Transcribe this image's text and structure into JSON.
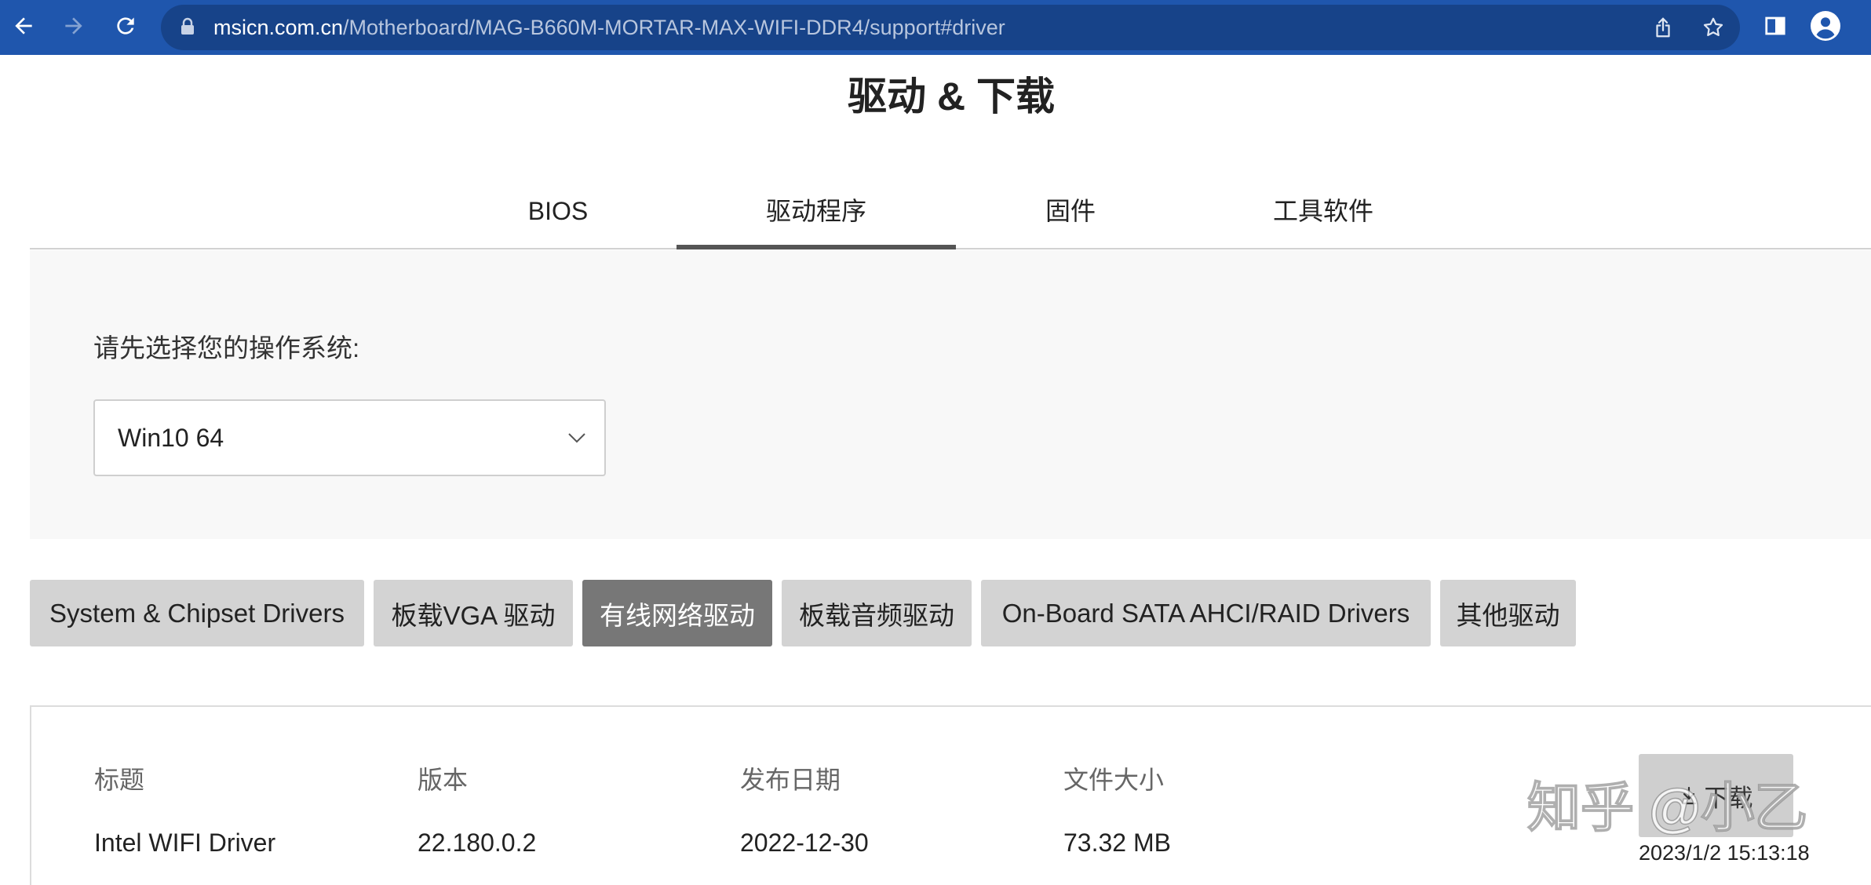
{
  "browser": {
    "url_domain": "msicn.com.cn",
    "url_path": "/Motherboard/MAG-B660M-MORTAR-MAX-WIFI-DDR4/support#driver",
    "icons": [
      "back-arrow-icon",
      "forward-arrow-icon",
      "reload-icon",
      "lock-icon",
      "share-icon",
      "star-icon",
      "side-panel-icon",
      "profile-icon"
    ]
  },
  "page": {
    "title": "驱动 & 下载",
    "tabs": [
      {
        "label": "BIOS",
        "active": false
      },
      {
        "label": "驱动程序",
        "active": true
      },
      {
        "label": "固件",
        "active": false
      },
      {
        "label": "工具软件",
        "active": false
      }
    ],
    "os_selector": {
      "label": "请先选择您的操作系统:",
      "selected": "Win10 64",
      "icon": "chevron-down-icon"
    },
    "categories": [
      {
        "label": "System & Chipset Drivers",
        "active": false
      },
      {
        "label": "板载VGA 驱动",
        "active": false
      },
      {
        "label": "有线网络驱动",
        "active": true
      },
      {
        "label": "板载音频驱动",
        "active": false
      },
      {
        "label": "On-Board SATA AHCI/RAID Drivers",
        "active": false
      },
      {
        "label": "其他驱动",
        "active": false
      }
    ],
    "table": {
      "headers": [
        "标题",
        "版本",
        "发布日期",
        "文件大小"
      ],
      "rows": [
        {
          "title": "Intel WIFI Driver",
          "version": "22.180.0.2",
          "release_date": "2022-12-30",
          "file_size": "73.32 MB",
          "download_label": "下载",
          "download_icon": "download-icon"
        }
      ]
    }
  },
  "overlay": {
    "watermark": "知乎 @小乙",
    "timestamp": "2023/1/2 15:13:18"
  },
  "colors": {
    "toolbar": "#1f56ad",
    "omnibox": "#174389",
    "panel_bg": "#f8f8f8",
    "category_bg": "#d3d3d3",
    "category_active_bg": "#777777",
    "tab_indicator": "#555555"
  }
}
